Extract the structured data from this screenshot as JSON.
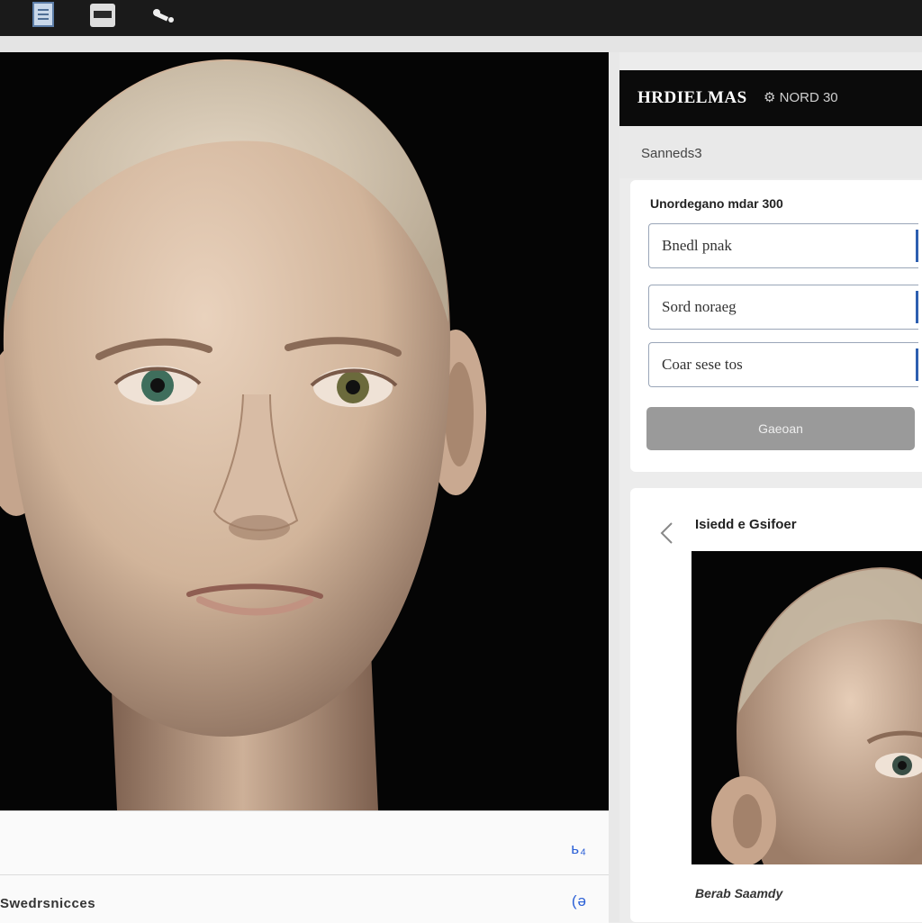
{
  "toolbar": {
    "icons": [
      "document-icon",
      "printer-icon",
      "wrench-icon"
    ]
  },
  "panel": {
    "title": "HRDIELMAS",
    "subtitle": "⚙ NORD 30",
    "section": "Sanneds3"
  },
  "form": {
    "label": "Unordegano mdar 300",
    "fields": [
      {
        "value": "Bnedl pnak"
      },
      {
        "value": "Sord noraeg"
      },
      {
        "value": "Coar sese tos"
      }
    ],
    "button_label": "Gaeoan"
  },
  "preview": {
    "title": "Isiedd e Gsifoer",
    "caption": "Berab Saamdy"
  },
  "bottom": {
    "link_1": "ь₄",
    "link_2": "(ə",
    "status": "Swedrsnicces"
  },
  "colors": {
    "toolbar_bg": "#1a1a1a",
    "viewport_bg": "#050505",
    "accent": "#2a5fd6",
    "button_bg": "#9a9a9a"
  }
}
